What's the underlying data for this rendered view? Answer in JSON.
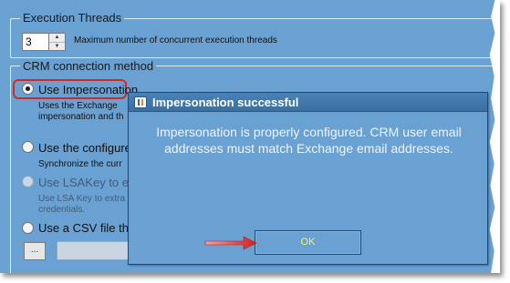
{
  "execution_threads": {
    "legend": "Execution Threads",
    "spinner_value": "3",
    "spinner_up": "▲",
    "spinner_down": "▼",
    "description": "Maximum number of concurrent execution threads"
  },
  "crm_connection": {
    "legend": "CRM connection method",
    "options": [
      {
        "label": "Use Impersonation",
        "description_lines": [
          "Uses the Exchange",
          "impersonation and th"
        ],
        "checked": true
      },
      {
        "label": "Use the configure",
        "description_lines": [
          "Synchronize the curr"
        ],
        "checked": false
      },
      {
        "label": "Use LSAKey to e",
        "description_lines": [
          "Use LSA Key to extra",
          "credentials."
        ],
        "checked": false,
        "disabled": true
      },
      {
        "label": "Use a CSV file th",
        "description_lines": [],
        "checked": false
      }
    ],
    "browse_label": "..."
  },
  "dialog": {
    "title": "Impersonation successful",
    "message": "Impersonation is properly configured.  CRM user email addresses must match Exchange email addresses.",
    "ok_label": "OK"
  },
  "colors": {
    "background": "#6aa1d3",
    "highlight": "#d62626",
    "ok_text": "#f6f070"
  }
}
